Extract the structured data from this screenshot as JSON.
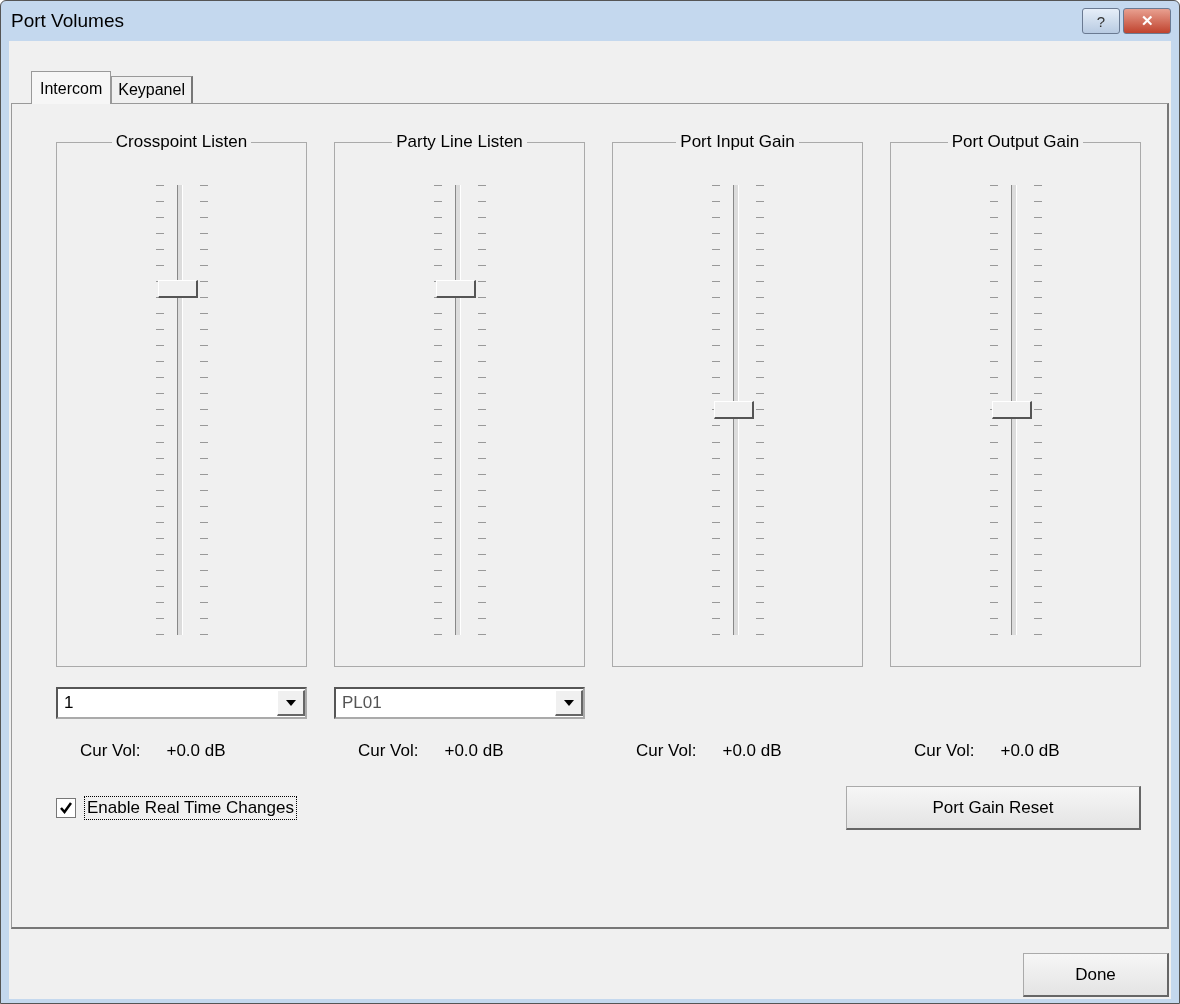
{
  "window": {
    "title": "Port Volumes",
    "help_button": "?",
    "close_button": "✕"
  },
  "tabs": [
    {
      "label": "Intercom",
      "selected": true
    },
    {
      "label": "Keypanel",
      "selected": false
    }
  ],
  "groups": [
    {
      "title": "Crosspoint Listen",
      "level": 0.77,
      "combo": "1",
      "combo_disabled": false,
      "cur_vol_label": "Cur Vol:",
      "cur_vol": "+0.0 dB"
    },
    {
      "title": "Party Line Listen",
      "level": 0.77,
      "combo": "PL01",
      "combo_disabled": true,
      "cur_vol_label": "Cur Vol:",
      "cur_vol": "+0.0 dB"
    },
    {
      "title": "Port Input Gain",
      "level": 0.5,
      "cur_vol_label": "Cur Vol:",
      "cur_vol": "+0.0 dB"
    },
    {
      "title": "Port Output Gain",
      "level": 0.5,
      "cur_vol_label": "Cur Vol:",
      "cur_vol": "+0.0 dB"
    }
  ],
  "realtime": {
    "label": "Enable Real Time Changes",
    "checked": true
  },
  "reset_button": "Port Gain Reset",
  "done_button": "Done"
}
